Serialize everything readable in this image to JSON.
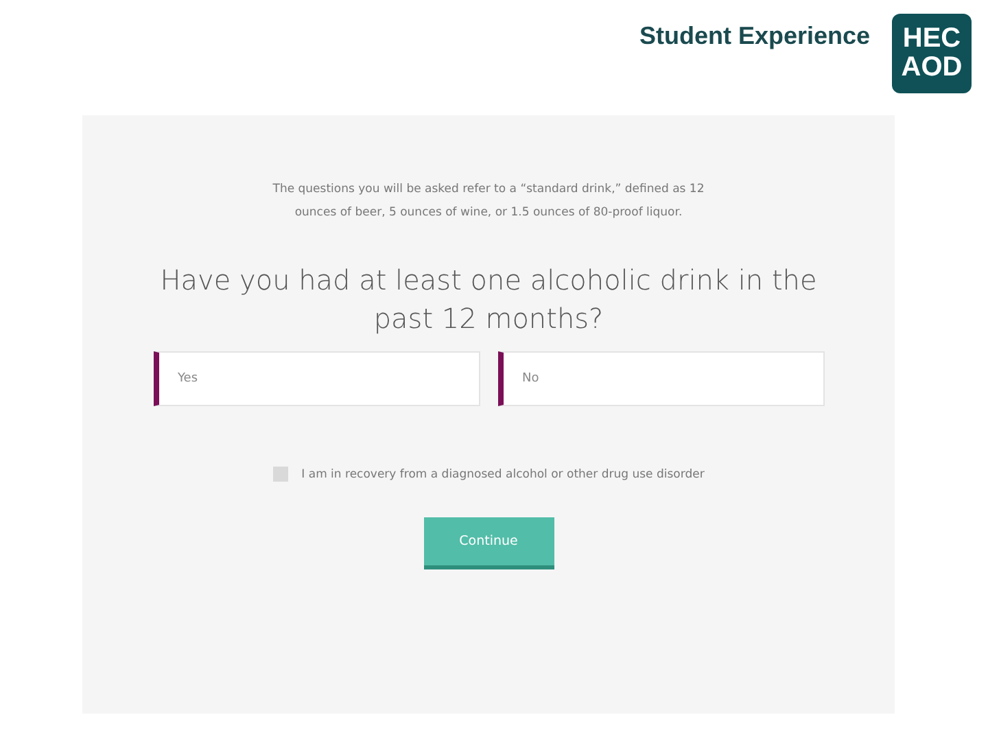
{
  "header": {
    "title": "Student Experience",
    "logo": [
      "HEC",
      "AOD"
    ]
  },
  "survey": {
    "intro": "The questions you will be asked refer to a “standard drink,” defined as 12 ounces of beer, 5 ounces of wine, or 1.5 ounces of 80-proof liquor.",
    "question": "Have you had at least one alcoholic drink in the past 12 months?",
    "options": [
      {
        "label": "Yes",
        "selected": false
      },
      {
        "label": "No",
        "selected": false
      }
    ],
    "recovery": {
      "label": "I am in recovery from a diagnosed alcohol or other drug use disorder",
      "checked": false
    },
    "button": "Continue"
  }
}
